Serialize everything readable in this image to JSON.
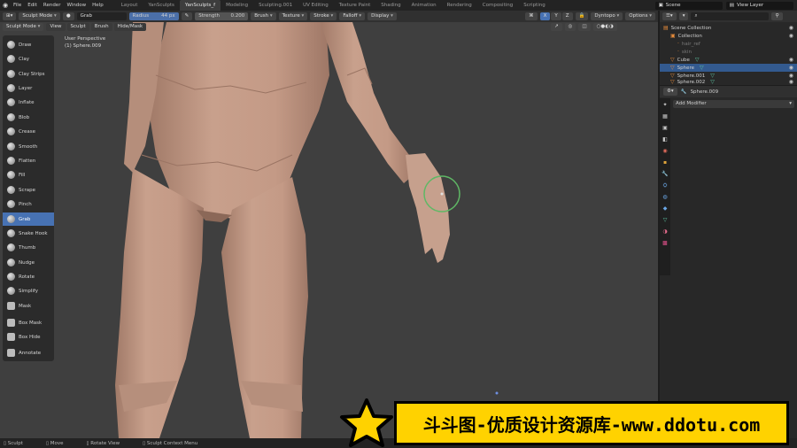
{
  "topbar": {
    "menu": [
      "File",
      "Edit",
      "Render",
      "Window",
      "Help"
    ],
    "workspaces": [
      {
        "label": "Layout",
        "active": false
      },
      {
        "label": "YanSculpts",
        "active": false
      },
      {
        "label": "YanSculpts_f",
        "active": true
      },
      {
        "label": "Modeling",
        "active": false
      },
      {
        "label": "Sculpting.001",
        "active": false
      },
      {
        "label": "UV Editing",
        "active": false
      },
      {
        "label": "Texture Paint",
        "active": false
      },
      {
        "label": "Shading",
        "active": false
      },
      {
        "label": "Animation",
        "active": false
      },
      {
        "label": "Rendering",
        "active": false
      },
      {
        "label": "Compositing",
        "active": false
      },
      {
        "label": "Scripting",
        "active": false
      }
    ],
    "scene": "Scene",
    "view_layer": "View Layer"
  },
  "tool_header": {
    "mode": "Sculpt Mode",
    "brush_name": "Grab",
    "radius_label": "Radius",
    "radius_value": "44 px",
    "strength_label": "Strength",
    "strength_value": "0.200",
    "menus": [
      "Brush",
      "Texture",
      "Stroke",
      "Falloff",
      "Display"
    ],
    "axes": [
      "X",
      "Y",
      "Z"
    ],
    "dyntopo": "Dyntopo",
    "options": "Options"
  },
  "viewport_header": {
    "menus": [
      "View",
      "Sculpt",
      "Brush",
      "Hide/Mask"
    ]
  },
  "viewport_overlay": {
    "perspective": "User Perspective",
    "object": "(1) Sphere.009"
  },
  "tools": [
    {
      "label": "Draw",
      "active": false
    },
    {
      "label": "Clay",
      "active": false
    },
    {
      "label": "Clay Strips",
      "active": false
    },
    {
      "label": "Layer",
      "active": false
    },
    {
      "label": "Inflate",
      "active": false
    },
    {
      "label": "Blob",
      "active": false
    },
    {
      "label": "Crease",
      "active": false
    },
    {
      "label": "Smooth",
      "active": false
    },
    {
      "label": "Flatten",
      "active": false
    },
    {
      "label": "Fill",
      "active": false
    },
    {
      "label": "Scrape",
      "active": false
    },
    {
      "label": "Pinch",
      "active": false
    },
    {
      "label": "Grab",
      "active": true
    },
    {
      "label": "Snake Hook",
      "active": false
    },
    {
      "label": "Thumb",
      "active": false
    },
    {
      "label": "Nudge",
      "active": false
    },
    {
      "label": "Rotate",
      "active": false
    },
    {
      "label": "Simplify",
      "active": false
    },
    {
      "label": "Mask",
      "active": false
    },
    {
      "label": "Box Mask",
      "active": false
    },
    {
      "label": "Box Hide",
      "active": false
    },
    {
      "label": "Annotate",
      "active": false
    }
  ],
  "outliner": {
    "rows": [
      {
        "label": "Scene Collection",
        "selected": false
      },
      {
        "label": "Collection",
        "selected": false
      },
      {
        "label": "hair_ref",
        "selected": false
      },
      {
        "label": "skin",
        "selected": false
      },
      {
        "label": "Cube",
        "selected": false
      },
      {
        "label": "Sphere",
        "selected": true
      },
      {
        "label": "Sphere.001",
        "selected": false
      },
      {
        "label": "Sphere.002",
        "selected": false
      }
    ]
  },
  "properties": {
    "object_name": "Sphere.009",
    "add_modifier": "Add Modifier"
  },
  "status": {
    "items": [
      "Sculpt",
      "Move",
      "Rotate View",
      "Sculpt Context Menu"
    ]
  },
  "watermark": {
    "text": "斗斗图-优质设计资源库-www.ddotu.com"
  },
  "colors": {
    "accent": "#4772b3",
    "watermark_bg": "#ffd200",
    "skin": "#c49a86",
    "viewport_bg": "#3f3f3f"
  }
}
